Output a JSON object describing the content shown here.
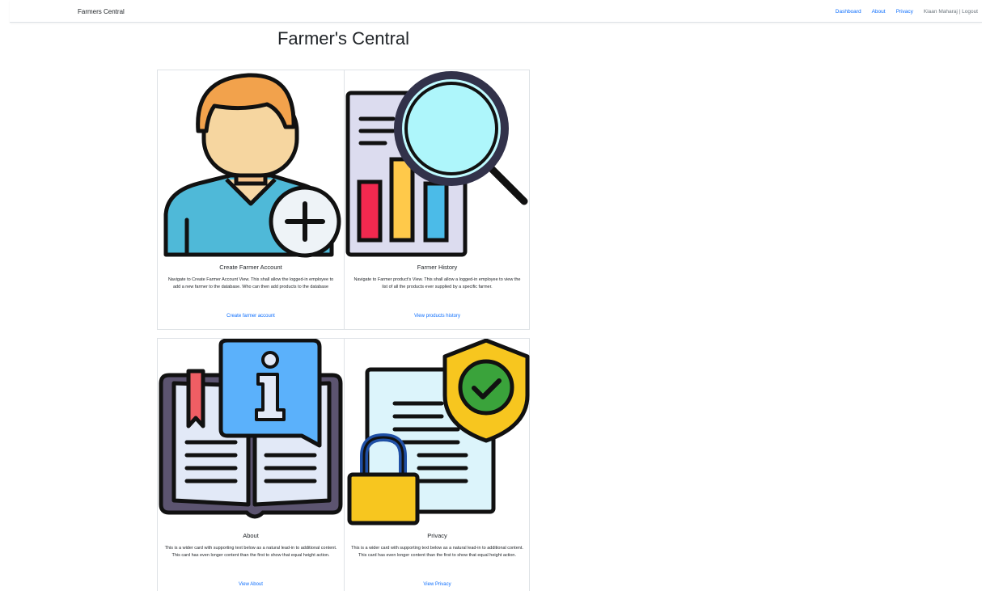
{
  "navbar": {
    "brand": "Farmers Central",
    "links": [
      "Dashboard",
      "About",
      "Privacy"
    ],
    "user_text": "Kiaan Maharaj | Logout"
  },
  "page": {
    "title": "Farmer's Central"
  },
  "cards": [
    {
      "title": "Create Farmer Account",
      "text": "Navigate to Create Farmer Account View. This shall allow the logged-in employee to add a new farmer to the database. Who can then add products to the database",
      "link": "Create farmer account",
      "icon": "add-user-icon"
    },
    {
      "title": "Farmer History",
      "text": "Navigate to Farmer product's View. This shall allow a logged-in employee to view the list of all the products ever supplied by a specific farmer.",
      "link": "View products history",
      "icon": "report-magnifier-icon"
    },
    {
      "title": "About",
      "text": "This is a wider card with supporting text below as a natural lead-in to additional content. This card has even longer content than the first to show that equal height action.",
      "link": "View About",
      "icon": "info-book-icon"
    },
    {
      "title": "Privacy",
      "text": "This is a wider card with supporting text below as a natural lead-in to additional content. This card has even longer content than the first to show that equal height action.",
      "link": "View Privacy",
      "icon": "privacy-shield-lock-icon"
    }
  ],
  "colors": {
    "link": "#0d6efd",
    "border": "#dee2e6",
    "muted": "#6c757d"
  }
}
